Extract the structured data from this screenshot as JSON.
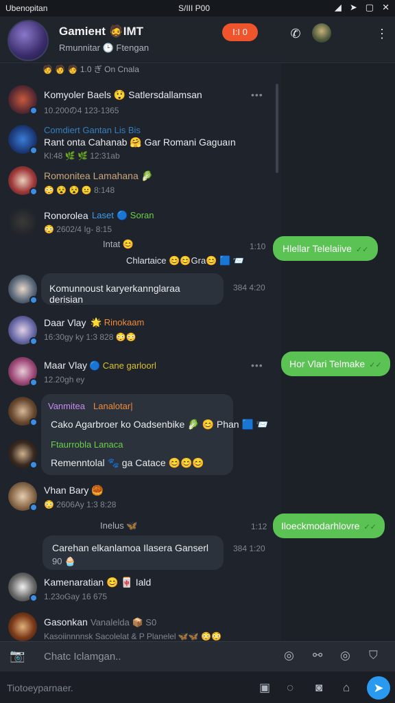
{
  "status_bar": {
    "left": "Ubenopitan",
    "center": "S/III P00"
  },
  "header": {
    "title": "Gamieнt 🧔IMT",
    "subtitle": "Rmunnitar 🕒 Ftengan",
    "badge": "I:I 0"
  },
  "chat": {
    "top_partial": "🧑 🧑 🧑  1.0 ぎ On Cnala",
    "rows": [
      {
        "name": "Komyoler Baels 😲 Satlersdallamsan",
        "sub": "10.200の4  123-1365",
        "more": "•••"
      },
      {
        "name": "Rant onta Cahanab 🤗 Gar Romani Gaguaın",
        "label": "Comdiert  Gantan Lis Bis",
        "sub": "Kl:48 🌿 🌿 12:31ab",
        "more": ""
      },
      {
        "name": "Romonitea Lamahana 🥬",
        "sub": "😳 😵 😵 😐 8:148",
        "more": ""
      },
      {
        "name": "Ronorolea",
        "label_blue": "Laset",
        "label_green": "🔵 Soran",
        "sub": "😳 2602/4  Ig- 8:15",
        "more": ""
      },
      {
        "name": "Komunnoust karyerkannglaraa derisian",
        "ts": "384 4:20"
      },
      {
        "name": "Daar Vlay",
        "label_orange": "🌟 Rinokaam",
        "sub": "16:30gy ky  1:3 828 😳😳"
      },
      {
        "name": "Maar Vlay",
        "label_yellow": "🔵 Cane garloorl",
        "sub": "12.20gh ey",
        "more": "•••"
      },
      {
        "name": "Vanmitea",
        "label_orange": "Lanalotar|",
        "text": "Cako Agarbroer ko Oadsenbike 🥬 😊 Phan 🟦 📨",
        "name2": "Ftaurrobla Lanaca",
        "text2": "Remenntolal 🐾 ga Catace 😊😊😊"
      },
      {
        "name": "Vhan Bary 🥮",
        "sub": "😳 2606Ay  1:3 8:28"
      },
      {
        "name": "Carehan elkanlamoa Ilasera Ganserl",
        "text2": "90 🧁",
        "ts": "384 1:20"
      },
      {
        "name": "Kamenaratian 😊 🀄 Iald",
        "sub": "1.23oGay  16 675"
      },
      {
        "name": "Gasonkan",
        "label": "Vanalelda 📦 S0",
        "sub": "Kasoiinnnnsk  Sacolelat  & P Planelel  🦋🦋 😳😳"
      }
    ],
    "outgoing": [
      {
        "text": "Hlellar Telelaiive",
        "tick": "✓✓",
        "ts": "1:10"
      },
      {
        "text": "Hor Vlari Telmake",
        "tick": "✓✓"
      },
      {
        "text": "Iloeckmodarhlovre",
        "tick": "✓✓",
        "ts": "1:12"
      }
    ],
    "inline": [
      {
        "text": "Intat 😊",
        "ts": ""
      },
      {
        "text": "Chlartaice 😊😊Gra😊 🟦 📨"
      },
      {
        "text": "Inelus 🦋"
      }
    ]
  },
  "composer": {
    "placeholder": "Chatc Iclamgan.."
  },
  "bottombar": {
    "placeholder": "Tiotoeyparnaer."
  },
  "colors": {
    "accent": "#2a9af0",
    "bubble_out": "#5bc254",
    "badge": "#f0542c"
  }
}
